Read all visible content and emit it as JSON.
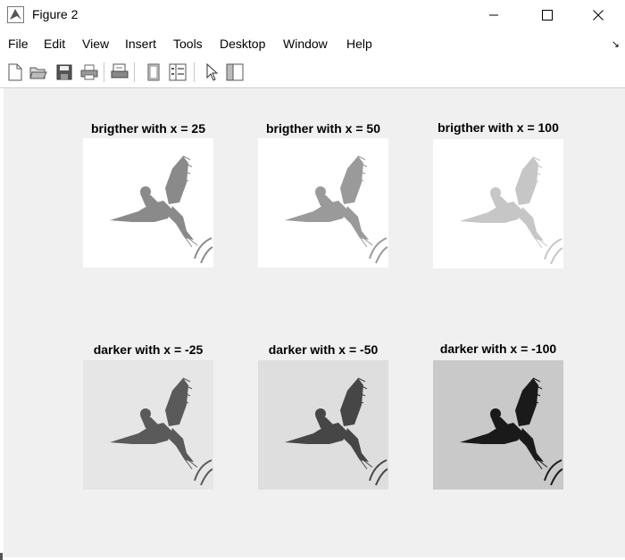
{
  "window": {
    "title": "Figure 2"
  },
  "menu": {
    "items": [
      "File",
      "Edit",
      "View",
      "Insert",
      "Tools",
      "Desktop",
      "Window",
      "Help"
    ]
  },
  "toolbar": {
    "buttons": [
      "new-figure-icon",
      "open-file-icon",
      "save-icon",
      "print-icon",
      "print-preview-icon",
      "hide-plot-tools-icon",
      "show-plot-tools-icon",
      "pointer-icon",
      "dock-icon"
    ]
  },
  "figure": {
    "panels": [
      {
        "title": "brigther with x = 25",
        "shade": "brighter-25"
      },
      {
        "title": "brigther with x = 50",
        "shade": "brighter-50"
      },
      {
        "title": "brigther with x = 100",
        "shade": "brighter-100"
      },
      {
        "title": "darker with x = -25",
        "shade": "darker-25"
      },
      {
        "title": "darker with x = -50",
        "shade": "darker-50"
      },
      {
        "title": "darker with x = -100",
        "shade": "darker-100"
      }
    ]
  }
}
